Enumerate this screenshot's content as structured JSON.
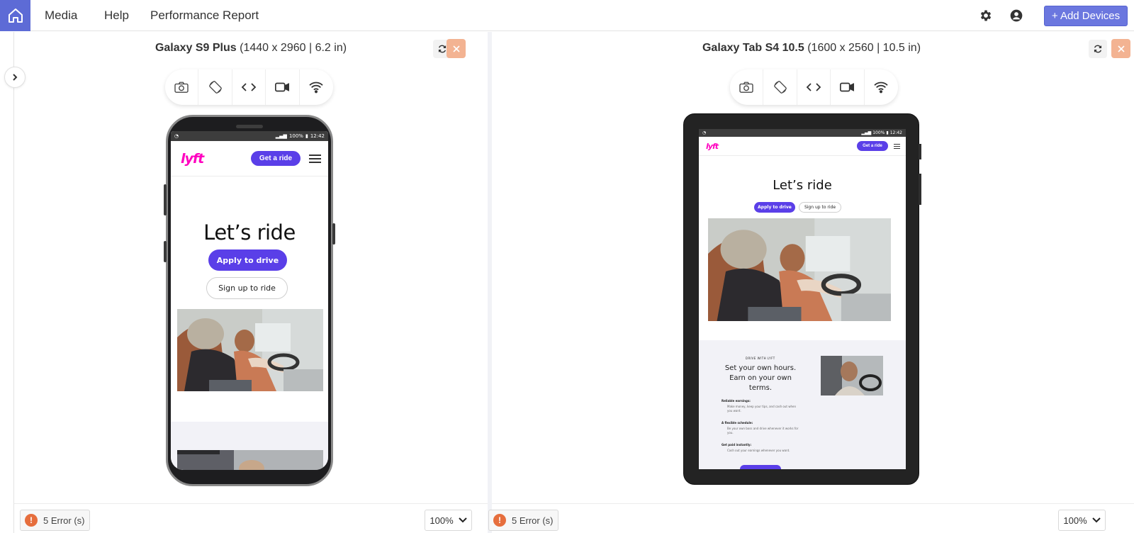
{
  "nav": {
    "links": [
      "Media",
      "Help",
      "Performance Report"
    ],
    "add_devices": "+ Add Devices"
  },
  "panels": [
    {
      "device_name": "Galaxy S9 Plus",
      "device_spec": " (1440 x 2960 | 6.2 in)",
      "errors": "5 Error (s)",
      "zoom": "100%",
      "site": {
        "status_battery": "100%",
        "status_time": "12:42",
        "logo": "lyft",
        "cta": "Get a ride",
        "headline": "Let’s ride",
        "apply": "Apply to drive",
        "signup": "Sign up to ride"
      }
    },
    {
      "device_name": "Galaxy Tab S4 10.5",
      "device_spec": " (1600 x 2560 | 10.5 in)",
      "errors": "5 Error (s)",
      "zoom": "100%",
      "site": {
        "status_battery": "100%",
        "status_time": "12:42",
        "logo": "lyft",
        "cta": "Get a ride",
        "headline": "Let’s ride",
        "apply": "Apply to drive",
        "signup": "Sign up to ride",
        "drive_kicker": "DRIVE WITH LYFT",
        "drive_headline": "Set your own hours. Earn on your own terms.",
        "features": [
          {
            "title": "Reliable earnings:",
            "desc": "Make money, keep your tips, and cash out when you want."
          },
          {
            "title": "A flexible schedule:",
            "desc": "Be your own boss and drive whenever it works for you."
          },
          {
            "title": "Get paid instantly:",
            "desc": "Cash out your earnings whenever you want."
          }
        ]
      }
    }
  ],
  "toolbar_icons": [
    "camera-icon",
    "rotate-icon",
    "code-icon",
    "video-icon",
    "wifi-icon"
  ],
  "colors": {
    "accent": "#6b77df",
    "home": "#5d6bd6",
    "close": "#f3b392",
    "error": "#e66e3d",
    "lyft_pink": "#ff00bf",
    "lyft_purple": "#5a3fe8"
  }
}
